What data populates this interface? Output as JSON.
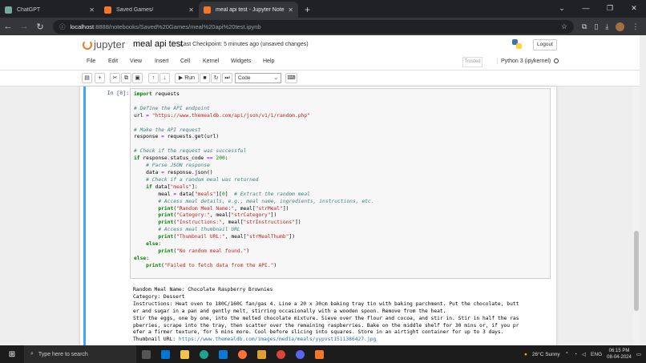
{
  "browser": {
    "tabs": [
      {
        "title": "ChatGPT",
        "favicon_color": "#74aa9c",
        "active": false
      },
      {
        "title": "Saved Games/",
        "favicon_color": "#f37726",
        "active": false
      },
      {
        "title": "meal api test - Jupyter Notebo",
        "favicon_color": "#f37726",
        "active": true
      }
    ],
    "new_tab": "+",
    "url_host": "localhost",
    "url_rest": ":8888/notebooks/Saved%20Games/meal%20api%20test.ipynb"
  },
  "jupyter": {
    "logo_text": "jupyter",
    "notebook_name": "meal api test",
    "checkpoint": "Last Checkpoint: 5 minutes ago  (unsaved changes)",
    "logout": "Logout",
    "menus": [
      "File",
      "Edit",
      "View",
      "Insert",
      "Cell",
      "Kernel",
      "Widgets",
      "Help"
    ],
    "trusted": "Trusted",
    "kernel": "Python 3 (ipykernel)",
    "run_label": "Run",
    "cell_type": "Code"
  },
  "cell": {
    "prompt": "In [8]:",
    "output_lines": [
      "Random Meal Name: Chocolate Raspberry Brownies",
      "Category: Dessert",
      "Instructions: Heat oven to 180C/160C fan/gas 4. Line a 20 x 30cm baking tray tin with baking parchment. Put the chocolate, butt",
      "er and sugar in a pan and gently melt, stirring occasionally with a wooden spoon. Remove from the heat.",
      "Stir the eggs, one by one, into the melted chocolate mixture. Sieve over the flour and cocoa, and stir in. Stir in half the ras",
      "pberries, scrape into the tray, then scatter over the remaining raspberries. Bake on the middle shelf for 30 mins or, if you pr",
      "efer a firmer texture, for 5 mins more. Cool before slicing into squares. Store in an airtight container for up to 3 days."
    ],
    "thumb_label": "Thumbnail URL: ",
    "thumb_url": "https://www.themealdb.com/images/media/meals/yypvst1511386427.jpg"
  },
  "taskbar": {
    "search_placeholder": "Type here to search",
    "weather": "26°C  Sunny",
    "lang": "ENG",
    "time": "06:15 PM",
    "date": "08-04-2024"
  }
}
